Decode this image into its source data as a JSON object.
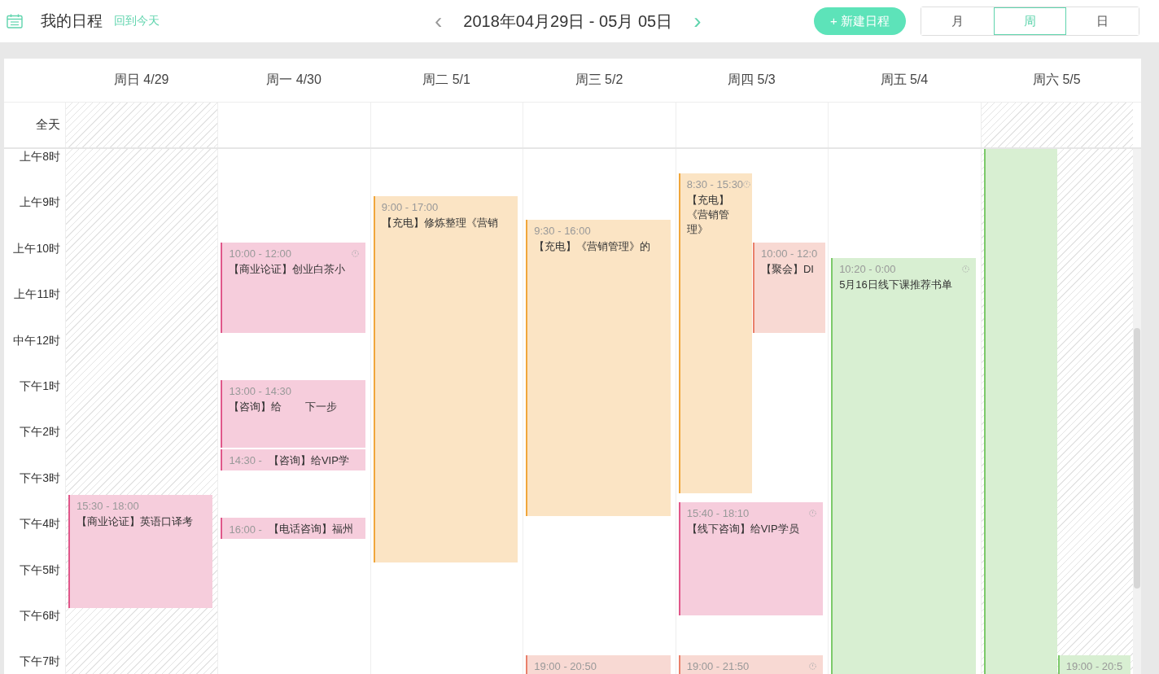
{
  "header": {
    "title": "我的日程",
    "today_link": "回到今天",
    "prev": "‹",
    "date_range": "2018年04月29日 - 05月 05日",
    "next": "›",
    "new_button": "+ 新建日程",
    "views": [
      {
        "label": "月",
        "selected": false
      },
      {
        "label": "周",
        "selected": true
      },
      {
        "label": "日",
        "selected": false
      }
    ]
  },
  "calendar": {
    "all_day_label": "全天",
    "hours": [
      "上午8时",
      "上午9时",
      "上午10时",
      "上午11时",
      "中午12时",
      "下午1时",
      "下午2时",
      "下午3时",
      "下午4时",
      "下午5时",
      "下午6时",
      "下午7时"
    ],
    "days": [
      {
        "label": "周日 4/29",
        "hatched": true,
        "events": [
          {
            "kind": "block",
            "time": "15:30 - 18:00",
            "title": "【商业论证】英语口译考",
            "color": "#e0578a",
            "clock": false,
            "offset": false
          }
        ]
      },
      {
        "label": "周一 4/30",
        "hatched": false,
        "events": [
          {
            "kind": "block",
            "time": "10:00 - 12:00",
            "title": "【商业论证】创业白茶小",
            "color": "#e0578a",
            "clock": true,
            "offset": false
          },
          {
            "kind": "block",
            "time": "13:00 - 14:30",
            "title": "【咨询】给        下一步",
            "color": "#e0578a",
            "clock": false,
            "offset": false
          },
          {
            "kind": "inline",
            "time": "14:30 -",
            "title": "【咨询】给VIP学",
            "color": "#e0578a",
            "offset": false
          },
          {
            "kind": "inline",
            "time": "16:00 -",
            "title": "【电话咨询】福州",
            "color": "#e0578a",
            "offset": false
          }
        ]
      },
      {
        "label": "周二 5/1",
        "hatched": false,
        "events": [
          {
            "kind": "block",
            "time": "9:00 - 17:00",
            "title": "【充电】修炼整理《营销",
            "color": "#f0a63b",
            "clock": false,
            "offset": false
          }
        ]
      },
      {
        "label": "周三 5/2",
        "hatched": false,
        "events": [
          {
            "kind": "block",
            "time": "9:30 - 16:00",
            "title": "【充电】《营销管理》的",
            "color": "#f0a63b",
            "clock": false,
            "offset": false
          },
          {
            "kind": "block",
            "time": "19:00 - 20:50",
            "color": "#e9806b",
            "clock": false,
            "offset": false
          }
        ]
      },
      {
        "label": "周四 5/3",
        "hatched": false,
        "events": [
          {
            "kind": "block",
            "time": "8:30 - 15:30",
            "title": "【充电】《营销管理》",
            "color": "#f0a63b",
            "clock": true,
            "offset": false
          },
          {
            "kind": "block",
            "time": "10:00 - 12:0",
            "title": "【聚会】DI",
            "color": "#e9806b",
            "clock": false,
            "offset": true
          },
          {
            "kind": "block",
            "time": "15:40 - 18:10",
            "title": "【线下咨询】给VIP学员",
            "color": "#e0578a",
            "clock": true,
            "offset": false
          },
          {
            "kind": "block",
            "time": "19:00 - 21:50",
            "color": "#e9806b",
            "clock": true,
            "offset": false
          }
        ]
      },
      {
        "label": "周五 5/4",
        "hatched": false,
        "events": [
          {
            "kind": "block",
            "time": "10:20 - 0:00",
            "title": "5月16日线下课推荐书单",
            "color": "#7cc96a",
            "clock": true,
            "offset": false
          }
        ]
      },
      {
        "label": "周六 5/5",
        "hatched": true,
        "events": [
          {
            "kind": "continuing",
            "color": "#7cc96a",
            "offset": false
          },
          {
            "kind": "block",
            "time": "19:00 - 20:5",
            "color": "#7cc96a",
            "clock": false,
            "offset": true
          }
        ]
      }
    ]
  }
}
